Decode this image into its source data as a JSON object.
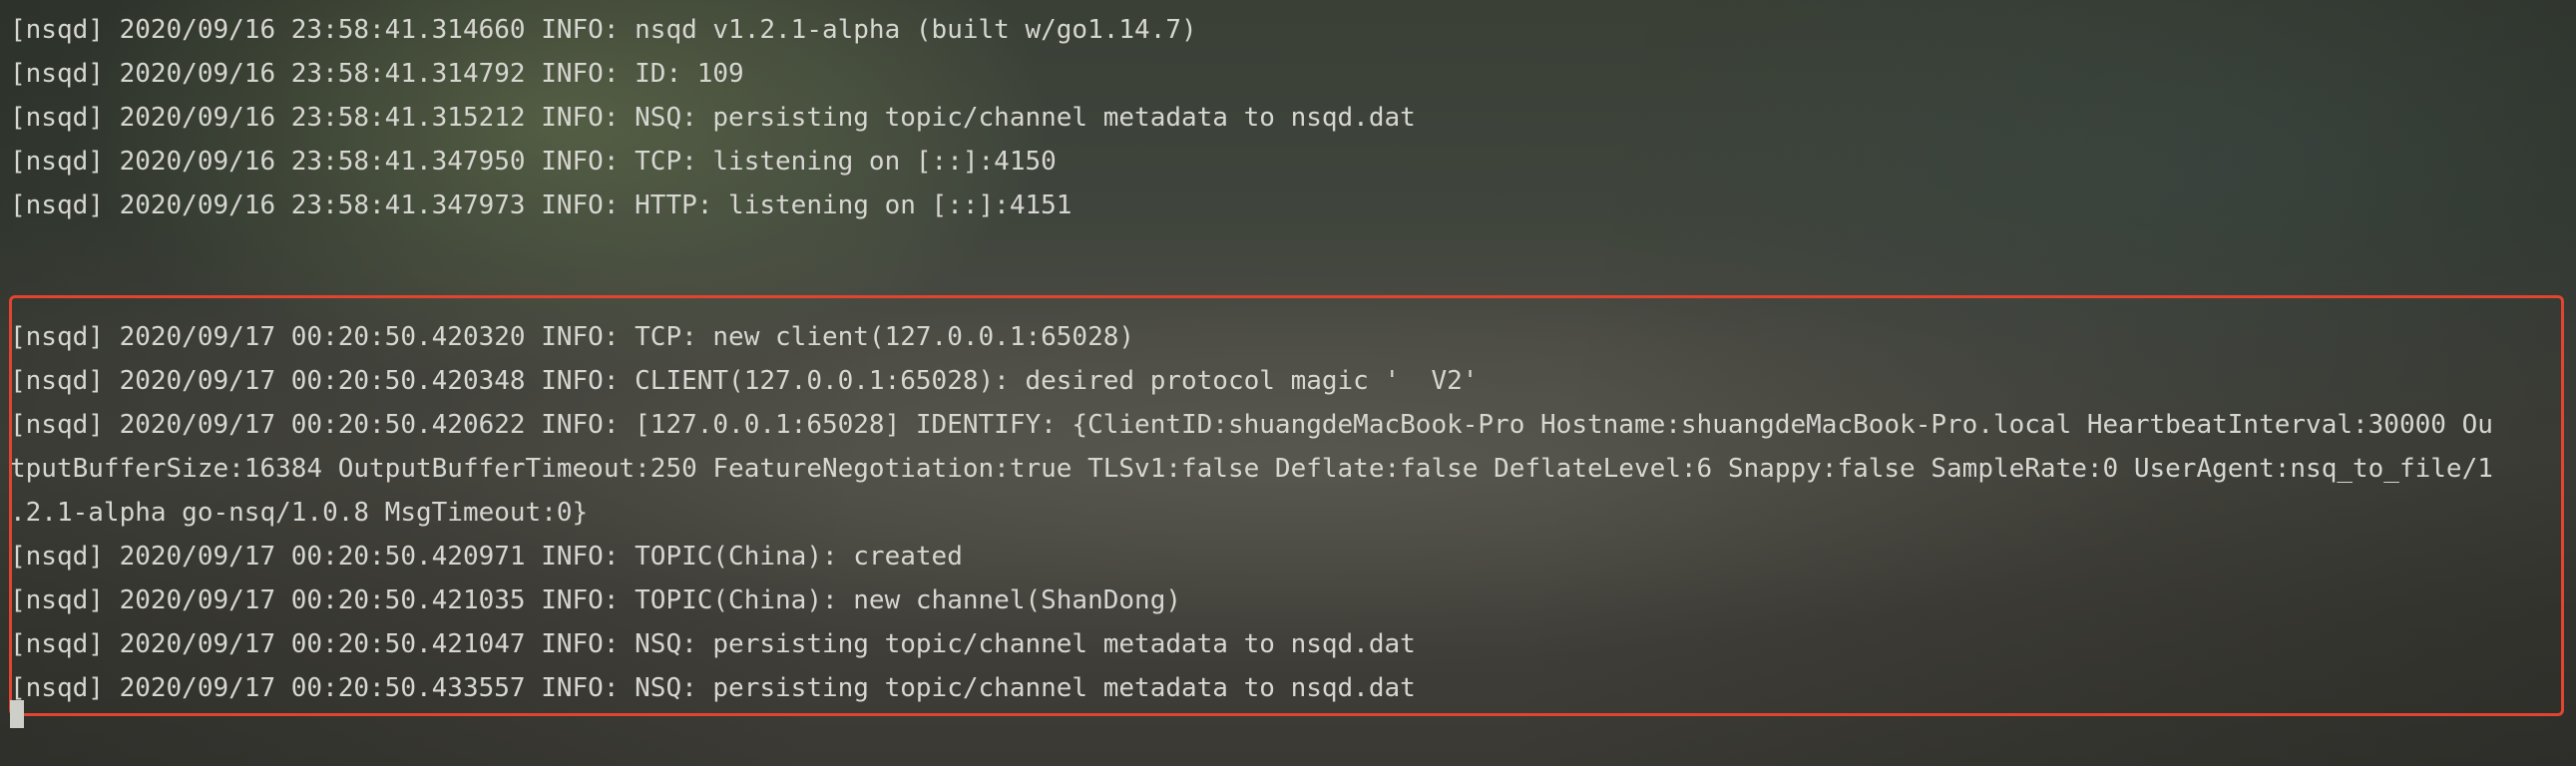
{
  "terminal": {
    "startup_lines": [
      "[nsqd] 2020/09/16 23:58:41.314660 INFO: nsqd v1.2.1-alpha (built w/go1.14.7)",
      "[nsqd] 2020/09/16 23:58:41.314792 INFO: ID: 109",
      "[nsqd] 2020/09/16 23:58:41.315212 INFO: NSQ: persisting topic/channel metadata to nsqd.dat",
      "[nsqd] 2020/09/16 23:58:41.347950 INFO: TCP: listening on [::]:4150",
      "[nsqd] 2020/09/16 23:58:41.347973 INFO: HTTP: listening on [::]:4151"
    ],
    "highlighted_lines": [
      "[nsqd] 2020/09/17 00:20:50.420320 INFO: TCP: new client(127.0.0.1:65028)",
      "[nsqd] 2020/09/17 00:20:50.420348 INFO: CLIENT(127.0.0.1:65028): desired protocol magic '  V2'",
      "[nsqd] 2020/09/17 00:20:50.420622 INFO: [127.0.0.1:65028] IDENTIFY: {ClientID:shuangdeMacBook-Pro Hostname:shuangdeMacBook-Pro.local HeartbeatInterval:30000 Ou",
      "tputBufferSize:16384 OutputBufferTimeout:250 FeatureNegotiation:true TLSv1:false Deflate:false DeflateLevel:6 Snappy:false SampleRate:0 UserAgent:nsq_to_file/1",
      ".2.1-alpha go-nsq/1.0.8 MsgTimeout:0}",
      "[nsqd] 2020/09/17 00:20:50.420971 INFO: TOPIC(China): created",
      "[nsqd] 2020/09/17 00:20:50.421035 INFO: TOPIC(China): new channel(ShanDong)",
      "[nsqd] 2020/09/17 00:20:50.421047 INFO: NSQ: persisting topic/channel metadata to nsqd.dat",
      "[nsqd] 2020/09/17 00:20:50.433557 INFO: NSQ: persisting topic/channel metadata to nsqd.dat"
    ],
    "highlight_color": "#e1442f",
    "text_color": "#d7d7d2"
  }
}
